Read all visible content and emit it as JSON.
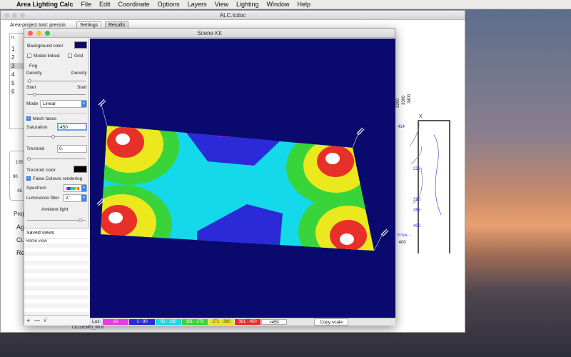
{
  "menubar": {
    "app_name": "Area Lighting Calc",
    "items": [
      "File",
      "Edit",
      "Coordinate",
      "Options",
      "Layers",
      "View",
      "Lighting",
      "Window",
      "Help"
    ]
  },
  "doc_window": {
    "title": "ALC.lcdoc",
    "tabs": [
      "Settings",
      "Results"
    ],
    "hint": "Area-project tool: pressin",
    "list_header": "n.",
    "list_rows": [
      "1",
      "2",
      "3",
      "4",
      "5",
      "6"
    ],
    "side_labels": [
      "Proje",
      "Agu",
      "Cu",
      "Ref"
    ],
    "protractor_labels": [
      "135",
      "90",
      "45"
    ],
    "status": "LID:DEMO_90.6",
    "contour_values": [
      "414",
      "239",
      "298",
      "356",
      "406"
    ],
    "ruler_values": [
      "3400",
      "3300",
      "3200"
    ],
    "axis_x": "X",
    "unit_text": "H lux, -",
    "value_400": ":400"
  },
  "scene_kit": {
    "title": "Scene Kit",
    "background_color_label": "Background color",
    "model_linked_label": "Model linked",
    "grid_label": "Grid",
    "fog_label": "Fog",
    "density_left": "Density",
    "density_right": "Density",
    "start_left": "Start",
    "start_right": "Start",
    "mode_label": "Mode",
    "mode_value": "Linear",
    "mesh_faces_label": "Mesh faces",
    "saturation_label": "Saturation",
    "saturation_value": "450",
    "treshold_label": "Treshold",
    "treshold_value": "0.",
    "treshold_color_label": "Treshold color",
    "false_colours_label": "False Colours rendering",
    "spectrum_label": "Spectrum",
    "luminance_filter_label": "Luminance filter",
    "luminance_filter_value": "2.'",
    "ambient_light_label": "Ambient light",
    "saved_views_label": "Saved views",
    "home_view_label": "Home view",
    "add_label": "+",
    "remove_label": "—",
    "check_label": "√",
    "lux_label": "Lux:",
    "legend": [
      {
        "text": "≤0",
        "color": "#e23ce0"
      },
      {
        "text": "1 - 90",
        "color": "#2a2ad8"
      },
      {
        "text": "91 - 180",
        "color": "#14d9ea"
      },
      {
        "text": "181 - 270",
        "color": "#39d43a"
      },
      {
        "text": "271 - 360",
        "color": "#ece81e"
      },
      {
        "text": "361 - 450",
        "color": "#e8302a"
      },
      {
        "text": ">450",
        "color": "#ffffff"
      }
    ],
    "copy_scale_label": "Copy scale"
  }
}
